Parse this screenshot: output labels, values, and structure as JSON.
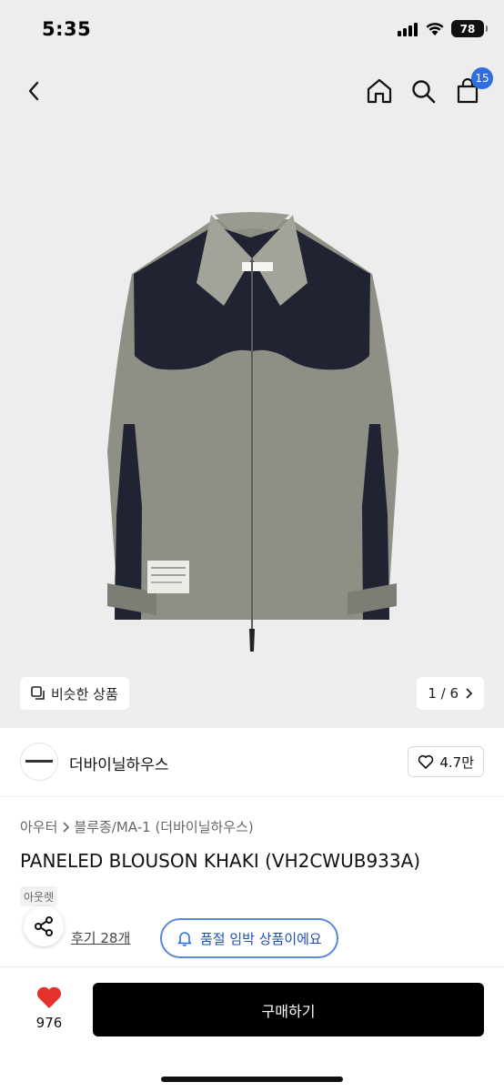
{
  "status": {
    "time": "5:35",
    "battery": "78"
  },
  "nav": {
    "cart_count": "15"
  },
  "gallery": {
    "similar_label": "비슷한 상품",
    "page_indicator": "1 / 6"
  },
  "shop": {
    "name": "더바이닐하우스",
    "likes": "4.7만"
  },
  "product": {
    "category": "아우터",
    "subcategory": "블루종/MA-1 (더바이닐하우스)",
    "title": "PANELED BLOUSON KHAKI (VH2CWUB933A)",
    "brand_tag": "아웃렛",
    "reviews": "후기 28개",
    "soldout_label": "품절 임박 상품이에요"
  },
  "bottom": {
    "wish_count": "976",
    "buy_label": "구매하기"
  },
  "colors": {
    "accent_blue": "#2f6de1",
    "heart_red": "#e5322d",
    "buy_black": "#000000",
    "jacket_gray": "#8e8f85",
    "jacket_navy": "#1f2332"
  }
}
